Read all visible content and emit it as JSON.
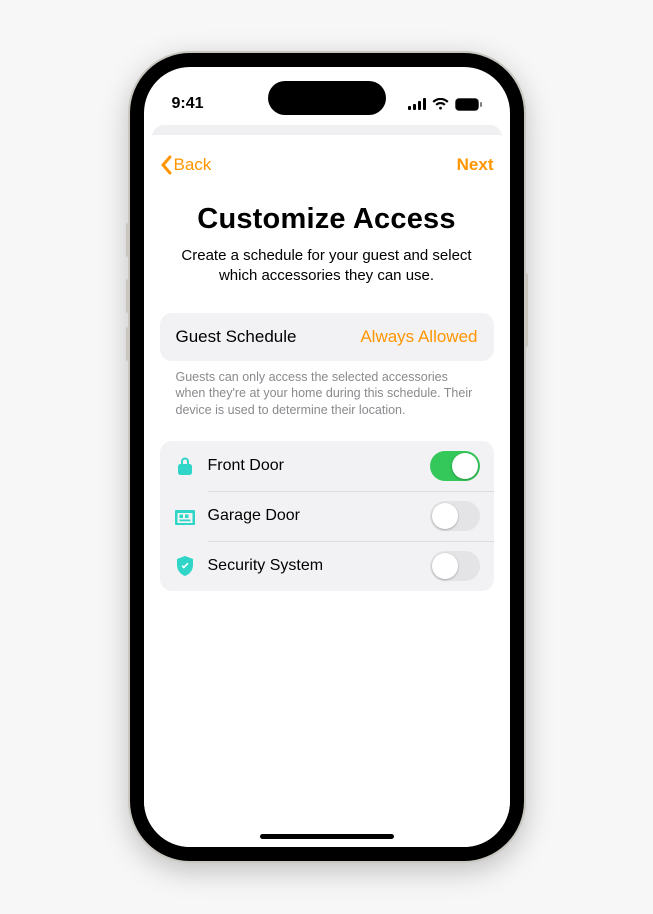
{
  "status": {
    "time": "9:41"
  },
  "nav": {
    "back": "Back",
    "next": "Next"
  },
  "page": {
    "title": "Customize Access",
    "subtitle": "Create a schedule for your guest and select which accessories they can use."
  },
  "schedule": {
    "label": "Guest Schedule",
    "value": "Always Allowed",
    "footnote": "Guests can only access the selected accessories when they're at your home during this schedule. Their device is used to determine their location."
  },
  "accessories": [
    {
      "icon": "lock",
      "label": "Front Door",
      "enabled": true
    },
    {
      "icon": "garage",
      "label": "Garage Door",
      "enabled": false
    },
    {
      "icon": "shield",
      "label": "Security System",
      "enabled": false
    }
  ],
  "colors": {
    "accent": "#ff9500",
    "toggle_on": "#34c759",
    "icon_teal": "#2fd6c8"
  }
}
